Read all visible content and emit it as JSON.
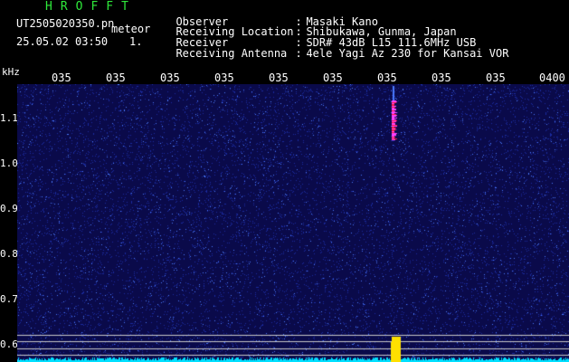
{
  "header": {
    "app_title": "HROFFT",
    "file_name": "UT2505020350.pn",
    "mode": "meteor",
    "date_time": "25.05.02 03:50",
    "counter": "1."
  },
  "info": [
    {
      "key": "Observer",
      "value": "Masaki Kano"
    },
    {
      "key": "Receiving Location",
      "value": "Shibukawa, Gunma, Japan"
    },
    {
      "key": "Receiver",
      "value": "SDR# 43dB L15 111.6MHz USB"
    },
    {
      "key": "Receiving Antenna",
      "value": "4ele Yagi Az 230 for Kansai VOR"
    }
  ],
  "spectrogram": {
    "y_unit": "kHz",
    "y_ticks": [
      "1.1",
      "1.0",
      "0.9",
      "0.8",
      "0.7",
      "0.6"
    ],
    "x_ticks": [
      "035",
      "035",
      "035",
      "035",
      "035",
      "035",
      "035",
      "035",
      "035",
      "0400"
    ],
    "colors": {
      "background": "#0a0a4a",
      "noise_low": "#1a2aa0",
      "noise_high": "#4a7aff",
      "echo_red": "#ff2040",
      "echo_magenta": "#ff40ff",
      "baseline": "#00e0ff",
      "carrier": "#ffe000",
      "reference_line": "#c8c8c8",
      "title_green": "#2ee83a"
    }
  }
}
